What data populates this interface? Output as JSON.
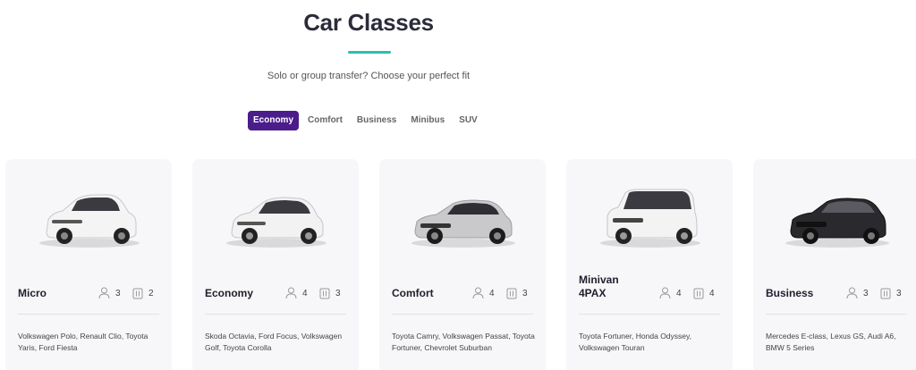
{
  "header": {
    "title": "Car Classes",
    "subtitle": "Solo or group transfer? Choose your perfect fit"
  },
  "tabs": [
    {
      "label": "Economy",
      "active": true
    },
    {
      "label": "Comfort",
      "active": false
    },
    {
      "label": "Business",
      "active": false
    },
    {
      "label": "Minibus",
      "active": false
    },
    {
      "label": "SUV",
      "active": false
    }
  ],
  "colors": {
    "accent": "#4a1d8a",
    "underline": "#2bbfb0",
    "card_bg": "#f7f7f9"
  },
  "cards": [
    {
      "name": "Micro",
      "passengers": "3",
      "luggage": "2",
      "models": "Volkswagen Polo, Renault Clio, Toyota Yaris, Ford Fiesta",
      "car_color": "white",
      "icons": [
        "person-icon",
        "luggage-icon"
      ]
    },
    {
      "name": "Economy",
      "passengers": "4",
      "luggage": "3",
      "models": "Skoda Octavia, Ford Focus, Volkswagen Golf, Toyota Corolla",
      "car_color": "white",
      "icons": [
        "person-icon",
        "luggage-icon"
      ]
    },
    {
      "name": "Comfort",
      "passengers": "4",
      "luggage": "3",
      "models": "Toyota Camry, Volkswagen Passat, Toyota Fortuner, Chevrolet Suburban",
      "car_color": "silver",
      "icons": [
        "person-icon",
        "luggage-icon"
      ]
    },
    {
      "name": "Minivan 4PAX",
      "passengers": "4",
      "luggage": "4",
      "models": "Toyota Fortuner, Honda Odyssey, Volkswagen Touran",
      "car_color": "white",
      "icons": [
        "person-icon",
        "luggage-icon"
      ]
    },
    {
      "name": "Business",
      "passengers": "3",
      "luggage": "3",
      "models": "Mercedes E-class, Lexus GS, Audi A6, BMW 5 Series",
      "car_color": "black",
      "icons": [
        "person-icon",
        "luggage-icon"
      ]
    }
  ]
}
